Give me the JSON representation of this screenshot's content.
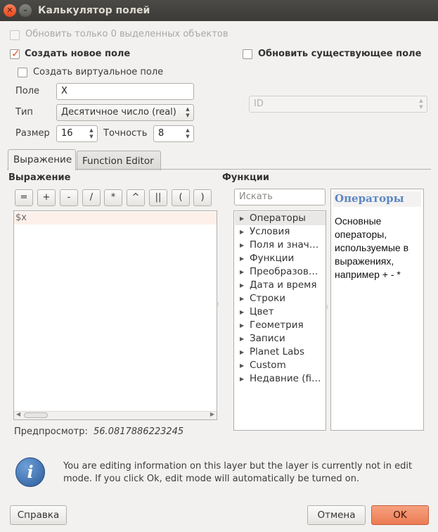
{
  "window": {
    "title": "Калькулятор полей",
    "close_glyph": "✕",
    "minimize_glyph": "–"
  },
  "options": {
    "update_selected_label": "Обновить только 0 выделенных объектов",
    "create_new_field_label": "Создать новое поле",
    "update_existing_label": "Обновить существующее поле",
    "create_virtual_label": "Создать виртуальное поле"
  },
  "new_field": {
    "name_label": "Поле",
    "name_value": "X",
    "type_label": "Тип",
    "type_value": "Десятичное число (real)",
    "size_label": "Размер",
    "size_value": "16",
    "precision_label": "Точность",
    "precision_value": "8"
  },
  "existing_field": {
    "value": "ID"
  },
  "tabs": [
    {
      "label": "Выражение",
      "active": true
    },
    {
      "label": "Function Editor",
      "active": false
    }
  ],
  "expression": {
    "heading": "Выражение",
    "operators": [
      "=",
      "+",
      "-",
      "/",
      "*",
      "^",
      "||",
      "(",
      ")"
    ],
    "text": "$x",
    "preview_label": "Предпросмотр:",
    "preview_value": "56.0817886223245"
  },
  "functions": {
    "heading": "Функции",
    "search_placeholder": "Искать",
    "items": [
      "Операторы",
      "Условия",
      "Поля и знач…",
      "Функции",
      "Преобразов…",
      "Дата и время",
      "Строки",
      "Цвет",
      "Геометрия",
      "Записи",
      "Planet Labs",
      "Custom",
      "Недавние (fi…"
    ],
    "help_title": "Операторы",
    "help_text": "Основные операторы, используемые в выражениях, например + - *"
  },
  "info": {
    "icon_glyph": "i",
    "message": "You are editing information on this layer but the layer is currently not in edit mode. If you click Ok, edit mode will automatically be turned on."
  },
  "buttons": {
    "help": "Справка",
    "cancel": "Отмена",
    "ok": "OK"
  },
  "colors": {
    "accent": "#e05a2b",
    "titlebar": "#3c3b37",
    "ok_button": "#ec7c54",
    "info_icon": "#2b5b98",
    "help_title": "#5b86c4"
  }
}
